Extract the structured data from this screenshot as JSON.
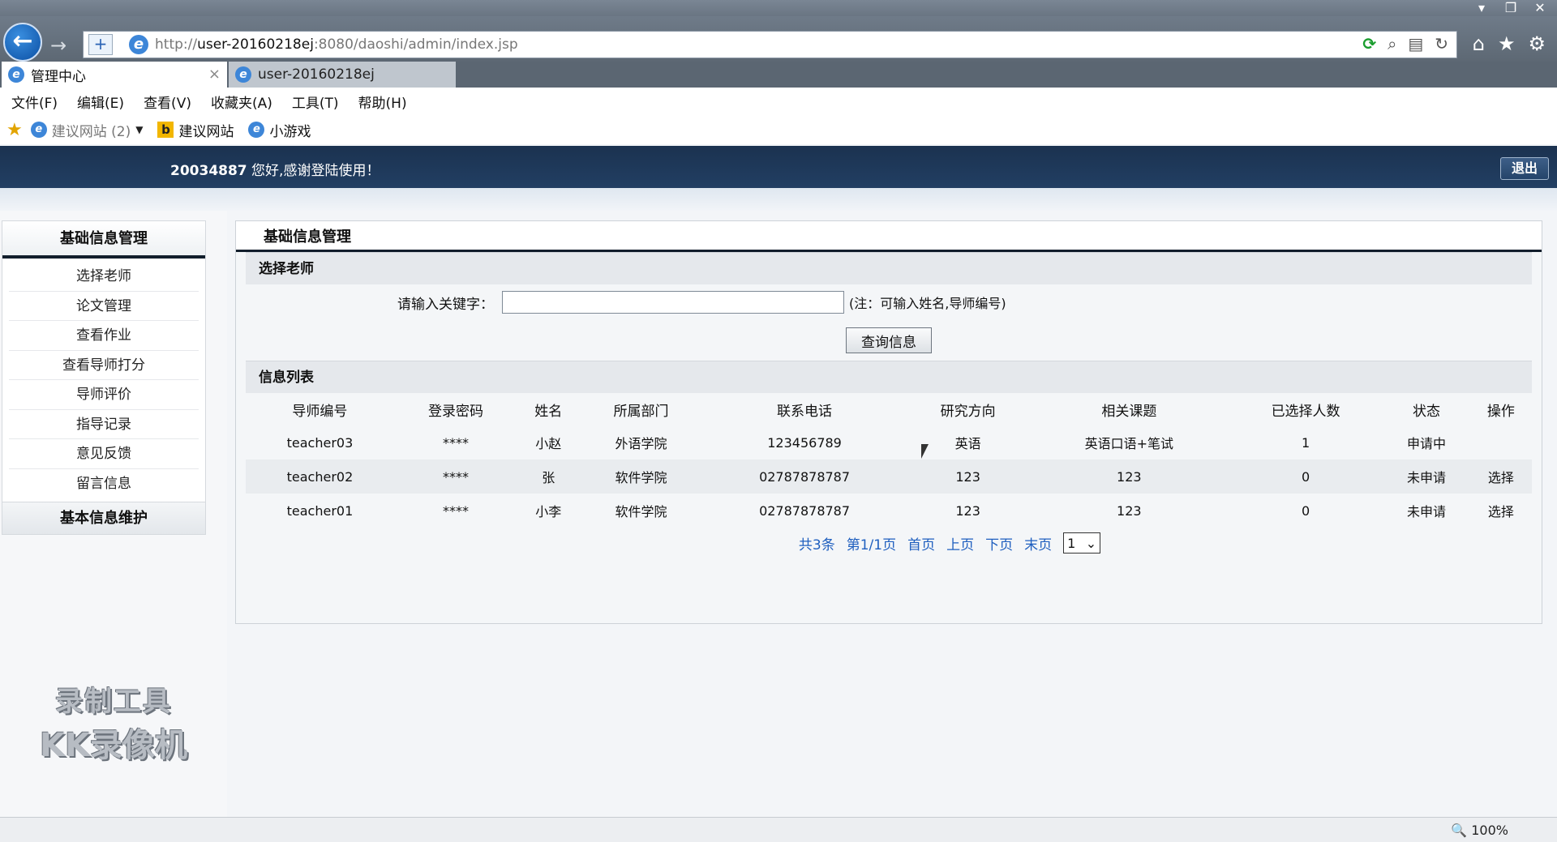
{
  "browser": {
    "url_domain": "user-20160218ej",
    "url_rest": ":8080/daoshi/admin/index.jsp",
    "url_prefix": "http://",
    "tabs": [
      {
        "label": "管理中心",
        "active": true
      },
      {
        "label": "user-20160218ej",
        "active": false
      }
    ],
    "menu": [
      "文件(F)",
      "编辑(E)",
      "查看(V)",
      "收藏夹(A)",
      "工具(T)",
      "帮助(H)"
    ],
    "favorites": [
      {
        "label": "建议网站 (2)",
        "icon": "ie-icon"
      },
      {
        "label": "建议网站",
        "icon": "bing-icon"
      },
      {
        "label": "小游戏",
        "icon": "ie-icon"
      }
    ],
    "zoom": "100%"
  },
  "header": {
    "user_id": "20034887",
    "welcome": "您好,感谢登陆使用！",
    "logout_label": "退出"
  },
  "sidebar": {
    "section1_title": "基础信息管理",
    "items": [
      "选择老师",
      "论文管理",
      "查看作业",
      "查看导师打分",
      "导师评价",
      "指导记录",
      "意见反馈",
      "留言信息"
    ],
    "section2_title": "基本信息维护"
  },
  "main": {
    "title": "基础信息管理",
    "search_section": "选择老师",
    "search_label": "请输入关键字：",
    "search_value": "",
    "search_hint": "(注：可输入姓名,导师编号)",
    "query_button": "查询信息",
    "list_section": "信息列表",
    "columns": [
      "导师编号",
      "登录密码",
      "姓名",
      "所属部门",
      "联系电话",
      "研究方向",
      "相关课题",
      "已选择人数",
      "状态",
      "操作"
    ],
    "rows": [
      [
        "teacher03",
        "****",
        "小赵",
        "外语学院",
        "123456789",
        "英语",
        "英语口语+笔试",
        "1",
        "申请中",
        ""
      ],
      [
        "teacher02",
        "****",
        "张",
        "软件学院",
        "02787878787",
        "123",
        "123",
        "0",
        "未申请",
        "选择"
      ],
      [
        "teacher01",
        "****",
        "小李",
        "软件学院",
        "02787878787",
        "123",
        "123",
        "0",
        "未申请",
        "选择"
      ]
    ],
    "pager": {
      "total": "共3条",
      "page_info": "第1/1页",
      "first": "首页",
      "prev": "上页",
      "next": "下页",
      "last": "末页",
      "selected_page": "1"
    }
  },
  "watermark": {
    "line1": "录制工具",
    "line2": "KK录像机"
  }
}
